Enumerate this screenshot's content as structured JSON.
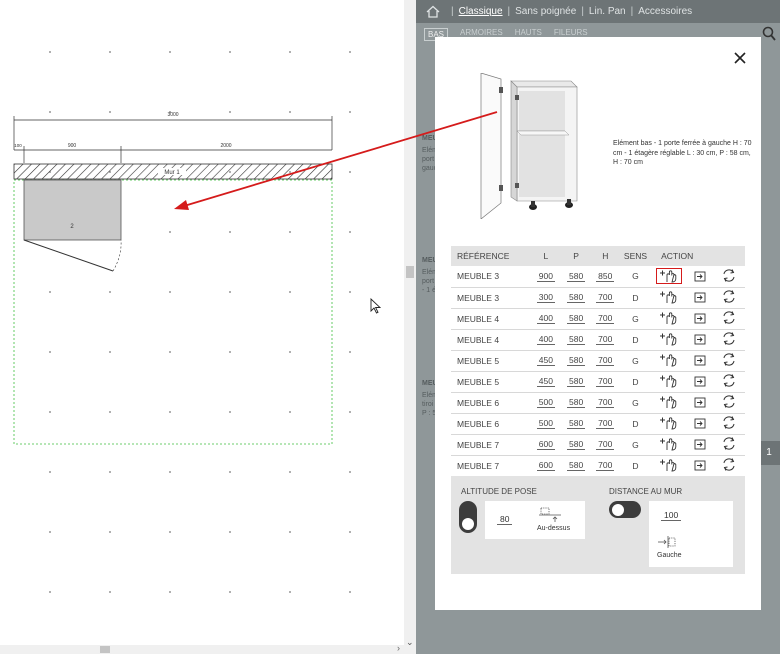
{
  "canvas": {
    "dimensions": {
      "total": "3000",
      "left_segment": "900",
      "right_segment": "2000",
      "small": "100"
    },
    "wall_label": "Mur 1",
    "cabinet_number": "2"
  },
  "nav": {
    "items": [
      "Classique",
      "Sans poignée",
      "Lin. Pan",
      "Accessoires"
    ],
    "active": "Classique"
  },
  "subtabs": [
    "BAS",
    "ARMOIRES",
    "HAUTS",
    "FILEURS"
  ],
  "background_fragments": {
    "meuble_a": "MEU",
    "text_a": "Elém\nport\ngauc",
    "meuble_b": "MEU",
    "text_b": "Elém\nport\n- 1 é",
    "meuble_c": "MEU",
    "text_c": "Elém\ntiroi\nP : 5",
    "page_number": "1"
  },
  "modal": {
    "description": "Elément bas - 1 porte ferrée à gauche H : 70 cm - 1 étagère réglable L : 30 cm, P : 58 cm, H : 70 cm",
    "table": {
      "headers": [
        "RÉFÉRENCE",
        "L",
        "P",
        "H",
        "SENS",
        "ACTION"
      ],
      "rows": [
        {
          "ref": "MEUBLE 3",
          "l": "900",
          "p": "580",
          "h": "850",
          "sens": "G"
        },
        {
          "ref": "MEUBLE 3",
          "l": "300",
          "p": "580",
          "h": "700",
          "sens": "D"
        },
        {
          "ref": "MEUBLE 4",
          "l": "400",
          "p": "580",
          "h": "700",
          "sens": "G"
        },
        {
          "ref": "MEUBLE 4",
          "l": "400",
          "p": "580",
          "h": "700",
          "sens": "D"
        },
        {
          "ref": "MEUBLE 5",
          "l": "450",
          "p": "580",
          "h": "700",
          "sens": "G"
        },
        {
          "ref": "MEUBLE 5",
          "l": "450",
          "p": "580",
          "h": "700",
          "sens": "D"
        },
        {
          "ref": "MEUBLE 6",
          "l": "500",
          "p": "580",
          "h": "700",
          "sens": "G"
        },
        {
          "ref": "MEUBLE 6",
          "l": "500",
          "p": "580",
          "h": "700",
          "sens": "D"
        },
        {
          "ref": "MEUBLE 7",
          "l": "600",
          "p": "580",
          "h": "700",
          "sens": "G"
        },
        {
          "ref": "MEUBLE 7",
          "l": "600",
          "p": "580",
          "h": "700",
          "sens": "D"
        }
      ]
    },
    "altitude": {
      "label": "ALTITUDE DE POSE",
      "value": "80",
      "position": "Au-dessus"
    },
    "distance": {
      "label": "DISTANCE AU MUR",
      "value": "100",
      "side": "Gauche"
    }
  },
  "colors": {
    "panel_bg": "#8f9799",
    "nav_bg": "#6d7476",
    "highlight": "#d51b1b",
    "toggle": "#3d3d3d"
  }
}
